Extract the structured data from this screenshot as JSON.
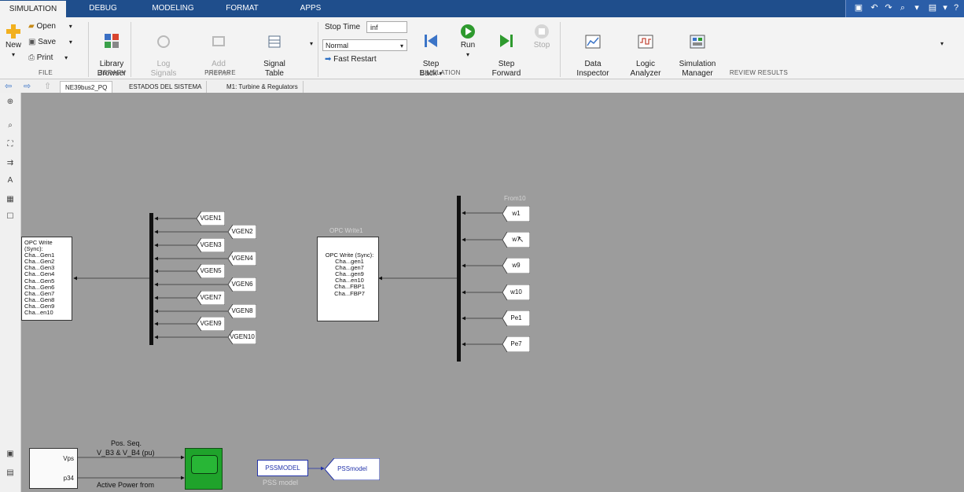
{
  "top_tabs": [
    "SIMULATION",
    "DEBUG",
    "MODELING",
    "FORMAT",
    "APPS"
  ],
  "ribbon": {
    "file": {
      "new": "New",
      "open": "Open",
      "save": "Save",
      "print": "Print",
      "label": "FILE"
    },
    "library": {
      "browser": "Library\nBrowser",
      "label": "LIBRARY"
    },
    "prepare": {
      "log_signals": "Log\nSignals",
      "add_viewer": "Add\nViewer",
      "signal_table": "Signal\nTable",
      "label": "PREPARE"
    },
    "simulation": {
      "stop_time_label": "Stop Time",
      "stop_time_value": "inf",
      "mode": "Normal",
      "fast_restart": "Fast Restart",
      "step_back": "Step\nBack",
      "run": "Run",
      "step_forward": "Step\nForward",
      "stop": "Stop",
      "label": "SIMULATION"
    },
    "review": {
      "data_inspector": "Data\nInspector",
      "logic_analyzer": "Logic\nAnalyzer",
      "simulation_manager": "Simulation\nManager",
      "label": "REVIEW RESULTS"
    }
  },
  "doc_tabs": [
    "NE39bus2_PQ",
    "ESTADOS DEL SISTEMA",
    "M1: Turbine & Regulators"
  ],
  "canvas": {
    "opc_write_left": {
      "title": "OPC Write (Sync):",
      "lines": [
        "Cha...Gen1",
        "Cha...Gen2",
        "Cha...Gen3",
        "Cha...Gen4",
        "Cha...Gen5",
        "Cha...Gen6",
        "Cha...Gen7",
        "Cha...Gen8",
        "Cha...Gen9",
        "Cha...en10"
      ]
    },
    "opc_write_right": {
      "name": "OPC Write1",
      "title": "OPC Write (Sync):",
      "lines": [
        "Cha...gen1",
        "Cha...gen7",
        "Cha...gen9",
        "Cha...en10",
        "Cha...FBP1",
        "Cha...FBP7"
      ]
    },
    "from_label": "From10",
    "vgen_tags": [
      "VGEN1",
      "VGEN2",
      "VGEN3",
      "VGEN4",
      "VGEN5",
      "VGEN6",
      "VGEN7",
      "VGEN8",
      "VGEN9",
      "VGEN10"
    ],
    "right_tags": [
      "w1",
      "w7",
      "w9",
      "w10",
      "Pe1",
      "Pe7"
    ],
    "scope_note_1": "Pos. Seq.",
    "scope_note_2": "V_B3 & V_B4 (pu)",
    "scope_note_3": "Active Power from",
    "port_vps": "Vps",
    "port_p34": "p34",
    "pss_block": "PSSMODEL",
    "pss_name": "PSS model",
    "pss_goto": "PSSmodel"
  },
  "colors": {
    "ribbon_blue": "#1f4e8c",
    "run_green": "#2e9a2e",
    "scope_green": "#1fa32b",
    "pss_blue": "#2233aa"
  }
}
